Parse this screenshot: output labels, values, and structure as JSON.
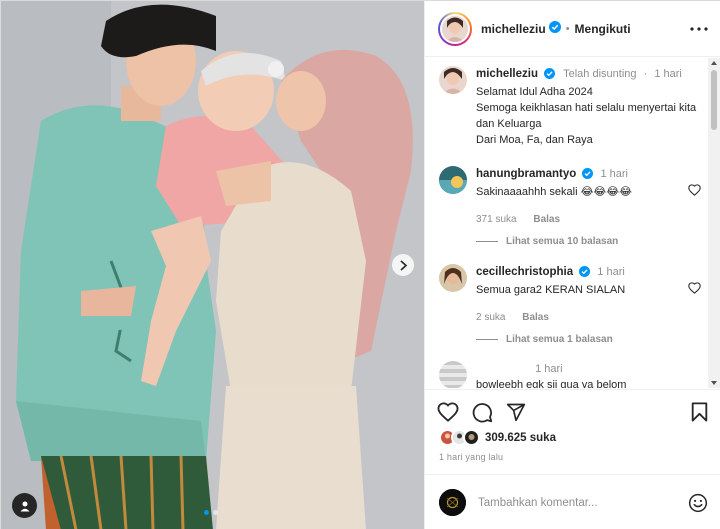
{
  "post": {
    "username": "michelleziu",
    "follow_state": "Mengikuti",
    "separator": "•",
    "photo_carousel": {
      "current": 1,
      "total": 2
    }
  },
  "caption": {
    "username": "michelleziu",
    "edited": "Telah disunting",
    "time": "1 hari",
    "text": "Selamat Idul Adha 2024\nSemoga keikhlasan hati selalu menyertai kita dan Keluarga\nDari Moa, Fa, dan Raya"
  },
  "comments": [
    {
      "username": "hanungbramantyo",
      "time": "1 hari",
      "text": "Sakinaaaahhh sekali 😂😂😂😂",
      "likes": "371 suka",
      "reply_label": "Balas",
      "view_replies": "Lihat semua 10 balasan"
    },
    {
      "username": "cecillechristophia",
      "time": "1 hari",
      "text": "Semua gara2 KERAN SIALAN",
      "likes": "2 suka",
      "reply_label": "Balas",
      "view_replies": "Lihat semua 1 balasan"
    },
    {
      "username": "",
      "time": "1 hari",
      "text": "bowleebh egk sii gua ya belom"
    }
  ],
  "engagement": {
    "likes": "309.625 suka",
    "date": "1 hari yang lalu"
  },
  "composer": {
    "placeholder": "Tambahkan komentar..."
  },
  "icons": {
    "verified": "verified-badge-icon",
    "more": "more-options-icon",
    "like": "heart-icon",
    "comment": "comment-icon",
    "share": "share-icon",
    "save": "bookmark-icon",
    "emoji": "emoji-icon",
    "next": "chevron-right-icon",
    "tagged": "user-tag-icon"
  },
  "colors": {
    "verified_blue": "#0095f6",
    "text": "#262626",
    "muted": "#8e8e8e"
  }
}
